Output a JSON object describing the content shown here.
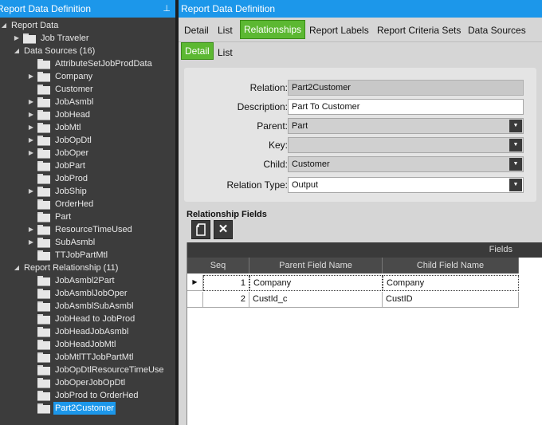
{
  "left_panel": {
    "title": "Report Data Definition",
    "pin_glyph": "⊥",
    "tree": [
      {
        "label": "Report Data",
        "level": 0,
        "arrow": "◢",
        "folder": false
      },
      {
        "label": "Job Traveler",
        "level": 1,
        "arrow": "▶",
        "folder": true
      },
      {
        "label": "Data Sources (16)",
        "level": 1,
        "arrow": "◢",
        "folder": false
      },
      {
        "label": "AttributeSetJobProdData",
        "level": 2,
        "arrow": "",
        "folder": true
      },
      {
        "label": "Company",
        "level": 2,
        "arrow": "▶",
        "folder": true
      },
      {
        "label": "Customer",
        "level": 2,
        "arrow": "",
        "folder": true
      },
      {
        "label": "JobAsmbl",
        "level": 2,
        "arrow": "▶",
        "folder": true
      },
      {
        "label": "JobHead",
        "level": 2,
        "arrow": "▶",
        "folder": true
      },
      {
        "label": "JobMtl",
        "level": 2,
        "arrow": "▶",
        "folder": true
      },
      {
        "label": "JobOpDtl",
        "level": 2,
        "arrow": "▶",
        "folder": true
      },
      {
        "label": "JobOper",
        "level": 2,
        "arrow": "▶",
        "folder": true
      },
      {
        "label": "JobPart",
        "level": 2,
        "arrow": "",
        "folder": true
      },
      {
        "label": "JobProd",
        "level": 2,
        "arrow": "",
        "folder": true
      },
      {
        "label": "JobShip",
        "level": 2,
        "arrow": "▶",
        "folder": true
      },
      {
        "label": "OrderHed",
        "level": 2,
        "arrow": "",
        "folder": true
      },
      {
        "label": "Part",
        "level": 2,
        "arrow": "",
        "folder": true
      },
      {
        "label": "ResourceTimeUsed",
        "level": 2,
        "arrow": "▶",
        "folder": true
      },
      {
        "label": "SubAsmbl",
        "level": 2,
        "arrow": "▶",
        "folder": true
      },
      {
        "label": "TTJobPartMtl",
        "level": 2,
        "arrow": "",
        "folder": true
      },
      {
        "label": "Report Relationship (11)",
        "level": 1,
        "arrow": "◢",
        "folder": false
      },
      {
        "label": "JobAsmbl2Part",
        "level": 2,
        "arrow": "",
        "folder": true
      },
      {
        "label": "JobAsmblJobOper",
        "level": 2,
        "arrow": "",
        "folder": true
      },
      {
        "label": "JobAsmblSubAsmbl",
        "level": 2,
        "arrow": "",
        "folder": true
      },
      {
        "label": "JobHead to JobProd",
        "level": 2,
        "arrow": "",
        "folder": true
      },
      {
        "label": "JobHeadJobAsmbl",
        "level": 2,
        "arrow": "",
        "folder": true
      },
      {
        "label": "JobHeadJobMtl",
        "level": 2,
        "arrow": "",
        "folder": true
      },
      {
        "label": "JobMtlTTJobPartMtl",
        "level": 2,
        "arrow": "",
        "folder": true
      },
      {
        "label": "JobOpDtlResourceTimeUse",
        "level": 2,
        "arrow": "",
        "folder": true
      },
      {
        "label": "JobOperJobOpDtl",
        "level": 2,
        "arrow": "",
        "folder": true
      },
      {
        "label": "JobProd to OrderHed",
        "level": 2,
        "arrow": "",
        "folder": true
      },
      {
        "label": "Part2Customer",
        "level": 2,
        "arrow": "",
        "folder": true,
        "selected": true
      }
    ]
  },
  "right_panel": {
    "title": "Report Data Definition",
    "tabs": [
      "Detail",
      "List",
      "Relationships",
      "Report Labels",
      "Report Criteria Sets",
      "Data Sources"
    ],
    "active_tab": "Relationships",
    "subtabs": [
      "Detail",
      "List"
    ],
    "active_subtab": "Detail"
  },
  "form": {
    "relation": {
      "label": "Relation:",
      "value": "Part2Customer"
    },
    "description": {
      "label": "Description:",
      "value": "Part To Customer"
    },
    "parent": {
      "label": "Parent:",
      "value": "Part"
    },
    "key": {
      "label": "Key:",
      "value": ""
    },
    "child": {
      "label": "Child:",
      "value": "Customer"
    },
    "relation_type": {
      "label": "Relation Type:",
      "value": "Output"
    }
  },
  "relationship_fields": {
    "title": "Relationship Fields",
    "new_icon": "new-document-icon",
    "delete_icon": "delete-x-icon",
    "group_header": "Fields",
    "columns": [
      "Seq",
      "Parent Field Name",
      "Child Field Name"
    ],
    "rows": [
      {
        "seq": "1",
        "parent": "Company",
        "child": "Company",
        "current": true
      },
      {
        "seq": "2",
        "parent": "CustId_c",
        "child": "CustID",
        "current": false
      }
    ]
  },
  "colors": {
    "accent": "#1c97ea",
    "active_tab": "#5cb832"
  }
}
